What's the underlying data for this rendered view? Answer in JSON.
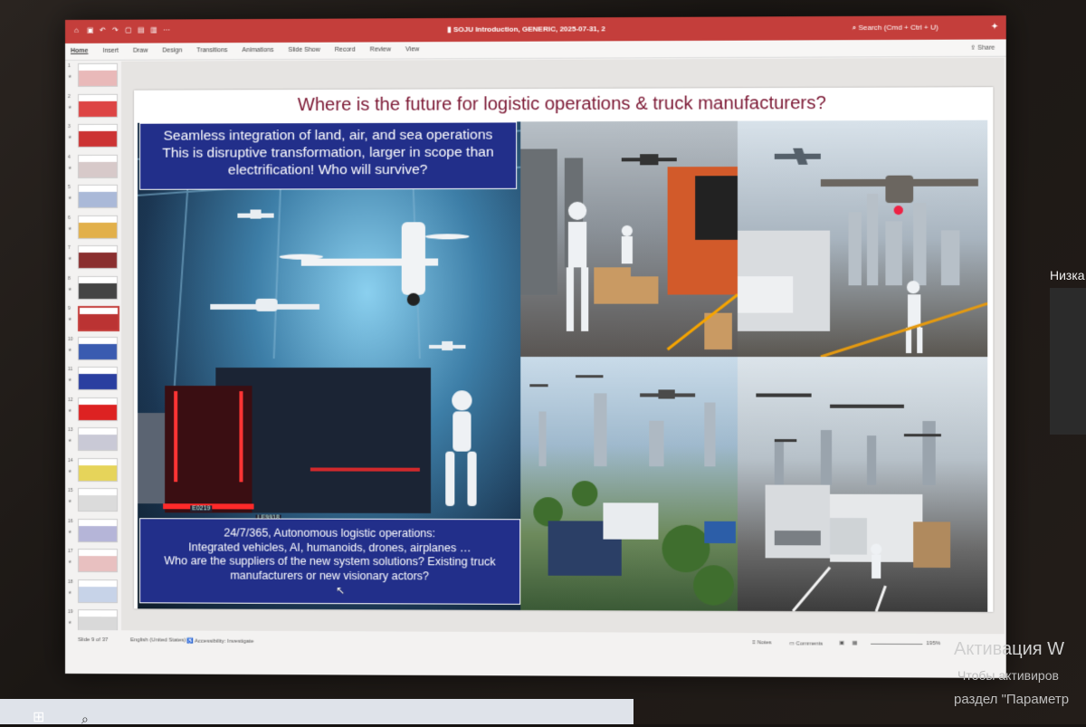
{
  "window": {
    "title": "SOJU Introduction, GENERIC, 2025-07-31, 2",
    "search_placeholder": "Search (Cmd + Ctrl + U)",
    "share_label": "Share"
  },
  "ribbon": {
    "tabs": [
      "Home",
      "Insert",
      "Draw",
      "Design",
      "Transitions",
      "Animations",
      "Slide Show",
      "Record",
      "Review",
      "View"
    ],
    "active_tab": "Home"
  },
  "thumbnails": {
    "numbers": [
      "1",
      "2",
      "3",
      "4",
      "5",
      "6",
      "7",
      "8",
      "9",
      "10",
      "11",
      "12",
      "13",
      "14",
      "15",
      "16",
      "17",
      "18",
      "19"
    ],
    "selected": "9",
    "colors": [
      "#e9b9b9",
      "#d44",
      "#c33",
      "#d7c9c9",
      "#aab9d8",
      "#e2b04a",
      "#8a2f2f",
      "#444",
      "#b33",
      "#3a5bb0",
      "#2a3fa0",
      "#d22",
      "#c9c9d6",
      "#e6d45a",
      "#dbdbdb",
      "#b5b5d8",
      "#e8c0c0",
      "#c7d3e8",
      "#d9d9d9"
    ]
  },
  "slide": {
    "title": "Where is the future for logistic operations & truck manufacturers?",
    "box_top": [
      "Seamless integration of land, air, and sea operations",
      "This is disruptive transformation, larger in scope than",
      "electrification! Who will survive?"
    ],
    "box_bottom": [
      "24/7/365, Autonomous logistic operations:",
      "Integrated vehicles, AI, humanoids, drones, airplanes …",
      "Who are the suppliers of the new system solutions? Existing truck",
      "manufacturers or new visionary actors?"
    ],
    "plate_1": "E0219",
    "plate_2": "LE9918"
  },
  "status": {
    "slide_indicator": "Slide 9 of 37",
    "language": "English (United States)",
    "accessibility": "Accessibility: Investigate",
    "notes": "Notes",
    "comments": "Comments",
    "zoom": "195%"
  },
  "os_overlay": {
    "side_label": "Низка",
    "activation_title": "Активация W",
    "activation_line2": "Чтобы активиров",
    "activation_line3": "раздел \"Параметр"
  },
  "colors": {
    "titlebar": "#c43e3b",
    "slide_title": "#7b1733",
    "textbox": "#222f8a"
  }
}
